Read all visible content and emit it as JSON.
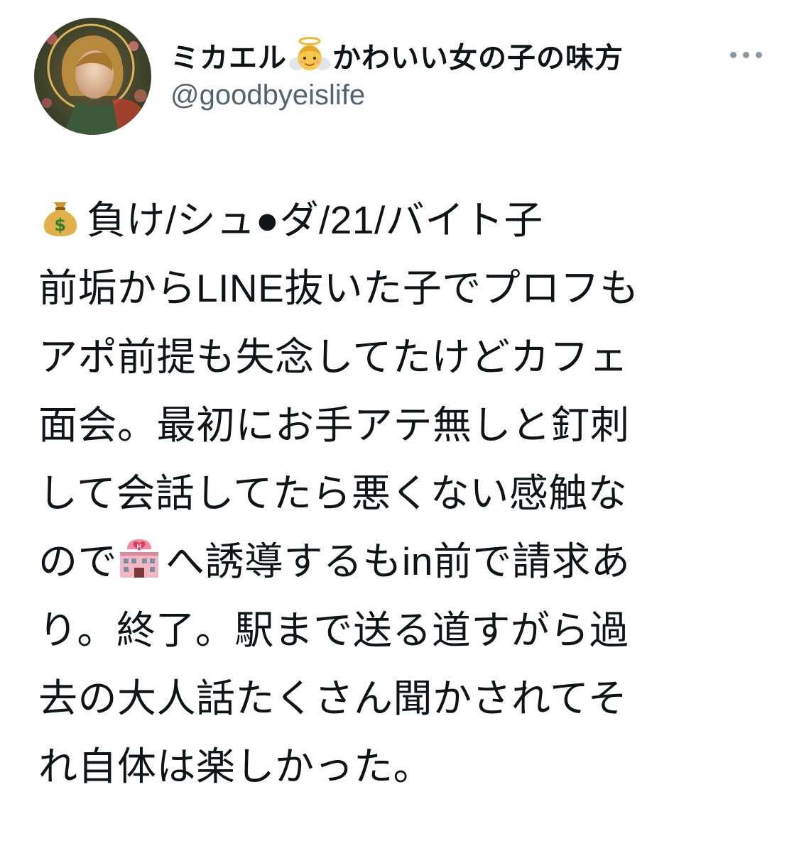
{
  "author": {
    "display_name": "ミカエル",
    "display_name_suffix": "かわいい女の子の味方",
    "name_emoji": "angel-icon",
    "handle": "@goodbyeislife",
    "avatar": "angel-portrait-avatar"
  },
  "more_menu": {
    "icon": "more-horizontal-icon"
  },
  "tweet": {
    "lines": [
      {
        "emoji": "money-bag-icon",
        "text": "負け/シュ●ダ/21/バイト子"
      },
      {
        "text": "前垢からLINE抜いた子でプロフも"
      },
      {
        "text": "アポ前提も失念してたけどカフェ"
      },
      {
        "text": "面会。最初にお手アテ無しと釘刺"
      },
      {
        "text": "して会話してたら悪くない感触な"
      },
      {
        "text_before": "ので",
        "emoji": "love-hotel-icon",
        "text_after": "へ誘導するもin前で請求あ"
      },
      {
        "text": "り。終了。駅まで送る道すがら過"
      },
      {
        "text": "去の大人話たくさん聞かされてそ"
      },
      {
        "text": "れ自体は楽しかった。"
      }
    ]
  },
  "colors": {
    "text_primary": "#0f1419",
    "text_secondary": "#536471",
    "more_dots": "#8b98a5",
    "background": "#ffffff"
  }
}
